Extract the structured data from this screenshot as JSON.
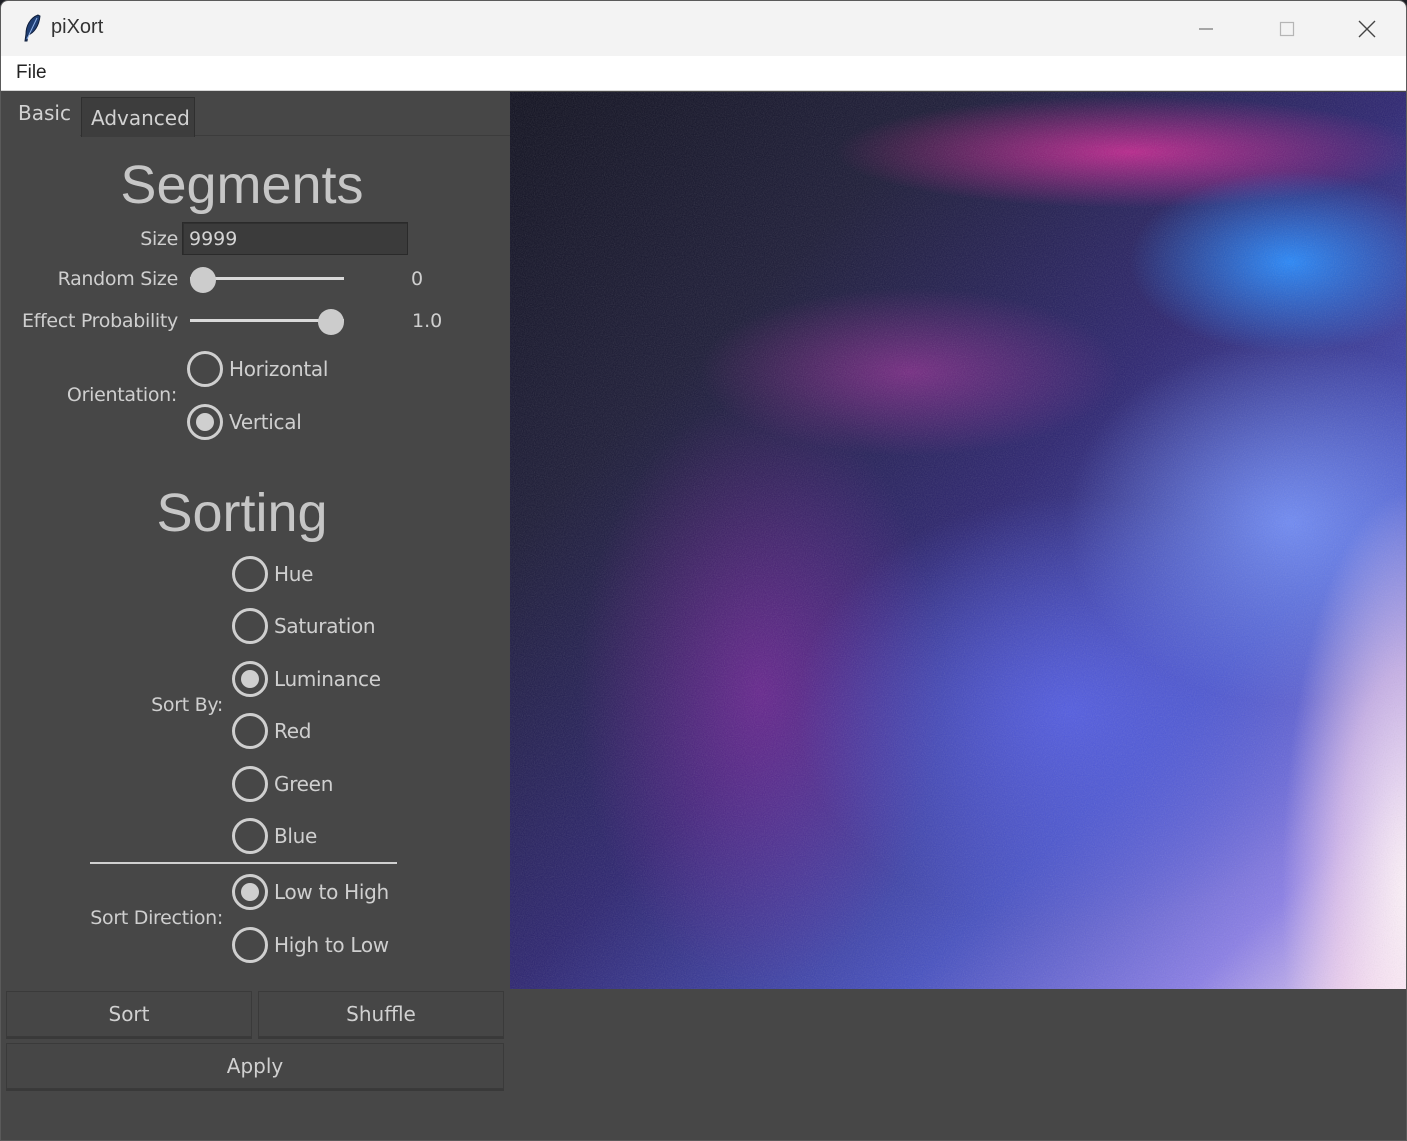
{
  "window": {
    "title": "piXort"
  },
  "menu": {
    "file": "File"
  },
  "tabs": [
    {
      "label": "Basic"
    },
    {
      "label": "Advanced"
    }
  ],
  "segments": {
    "heading": "Segments",
    "size_label": "Size",
    "size_value": "9999",
    "random_size_label": "Random Size",
    "random_size_value": "0",
    "random_size_level": 0,
    "effect_probability_label": "Effect Probability",
    "effect_probability_value": "1.0",
    "effect_probability_level": 1.0,
    "orientation_label": "Orientation:",
    "orientation_options": [
      {
        "label": "Horizontal",
        "checked": false
      },
      {
        "label": "Vertical",
        "checked": true
      }
    ]
  },
  "sorting": {
    "heading": "Sorting",
    "sort_by_label": "Sort By:",
    "sort_by_options": [
      {
        "label": "Hue",
        "checked": false
      },
      {
        "label": "Saturation",
        "checked": false
      },
      {
        "label": "Luminance",
        "checked": true
      },
      {
        "label": "Red",
        "checked": false
      },
      {
        "label": "Green",
        "checked": false
      },
      {
        "label": "Blue",
        "checked": false
      }
    ],
    "sort_direction_label": "Sort Direction:",
    "sort_direction_options": [
      {
        "label": "Low to High",
        "checked": true
      },
      {
        "label": "High to Low",
        "checked": false
      }
    ]
  },
  "buttons": {
    "sort": "Sort",
    "shuffle": "Shuffle",
    "apply": "Apply"
  },
  "colors": {
    "panel_bg": "#474747",
    "text": "#cfcfcf",
    "titlebar_bg": "#f3f3f3"
  }
}
